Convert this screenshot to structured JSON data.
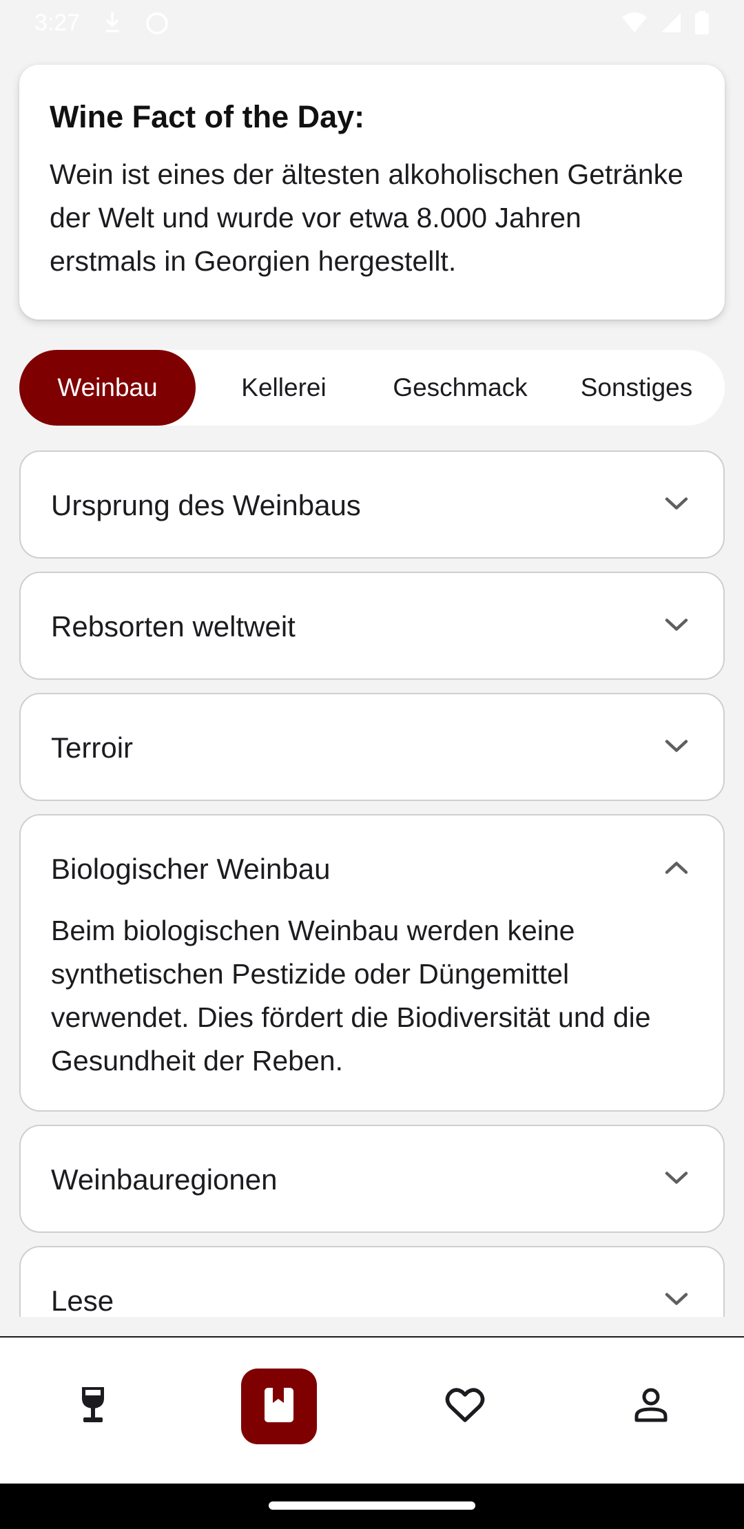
{
  "status_bar": {
    "time": "3:27",
    "icons": [
      "download-icon",
      "face-icon",
      "wifi-icon",
      "signal-icon",
      "battery-icon"
    ]
  },
  "fact_card": {
    "title": "Wine Fact of the Day:",
    "text": "Wein ist eines der ältesten alkoholischen Getränke der Welt und wurde vor etwa 8.000 Jahren erstmals in Georgien hergestellt."
  },
  "tabs": [
    {
      "label": "Weinbau",
      "selected": true
    },
    {
      "label": "Kellerei",
      "selected": false
    },
    {
      "label": "Geschmack",
      "selected": false
    },
    {
      "label": "Sonstiges",
      "selected": false
    }
  ],
  "accordion": [
    {
      "title": "Ursprung des Weinbaus",
      "expanded": false
    },
    {
      "title": "Rebsorten weltweit",
      "expanded": false
    },
    {
      "title": "Terroir",
      "expanded": false
    },
    {
      "title": "Biologischer Weinbau",
      "expanded": true,
      "body": "Beim biologischen Weinbau werden keine synthetischen Pestizide oder Düngemittel verwendet. Dies fördert die Biodiversität und die Gesundheit der Reben."
    },
    {
      "title": "Weinbauregionen",
      "expanded": false
    },
    {
      "title": "Lese",
      "expanded": false
    }
  ],
  "bottom_nav": [
    {
      "icon": "wine-glass-icon",
      "selected": false
    },
    {
      "icon": "book-icon",
      "selected": true
    },
    {
      "icon": "heart-icon",
      "selected": false
    },
    {
      "icon": "person-icon",
      "selected": false
    }
  ],
  "colors": {
    "accent": "#7f0000",
    "background": "#f3f3f3",
    "card": "#ffffff",
    "border": "#cfcfcf"
  }
}
